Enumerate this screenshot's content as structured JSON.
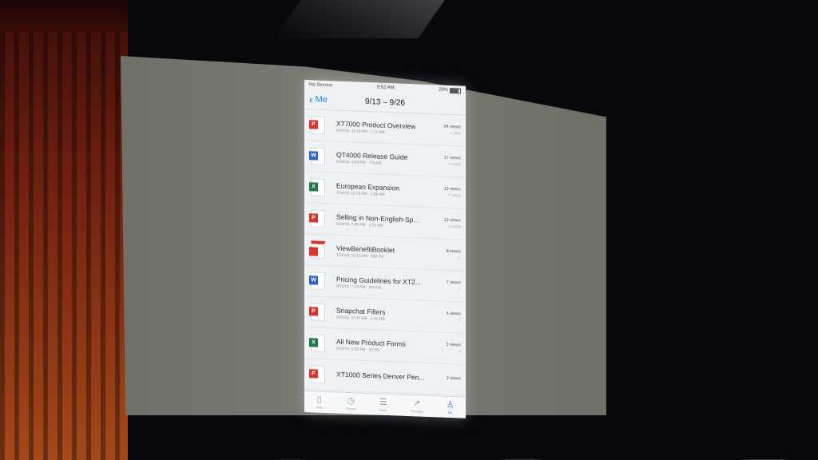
{
  "status_bar": {
    "carrier": "No Service",
    "time": "9:52 AM",
    "battery": "28%"
  },
  "nav": {
    "back_label": "Me",
    "title": "9/13 – 9/26"
  },
  "files": [
    {
      "icon": "powerpoint-icon",
      "type": "ppt",
      "badge": "P",
      "title": "XT7000 Product Overview",
      "meta": "9/20/16, 10:16 AM · 1.11 MB",
      "views": "54 views",
      "trend": "↗ 26%"
    },
    {
      "icon": "word-icon",
      "type": "doc",
      "badge": "W",
      "title": "QT4000 Release Guide",
      "meta": "9/16/16, 3:03 PM · 776 KB",
      "views": "17 views",
      "trend": "↗ 100%"
    },
    {
      "icon": "excel-icon",
      "type": "xls",
      "badge": "X",
      "title": "European Expansion",
      "meta": "9/16/16, 11:03 AM · 1.95 MB",
      "views": "13 views",
      "trend": "↗ 100%"
    },
    {
      "icon": "powerpoint-icon",
      "type": "ppt",
      "badge": "P",
      "title": "Selling in Non-English-Sp...",
      "meta": "9/16/16, 7:45 PM · 1.15 MB",
      "views": "13 views",
      "trend": "↗ 100%"
    },
    {
      "icon": "pdf-icon",
      "type": "pdf",
      "badge": "",
      "title": "ViewBenefitBooklet",
      "meta": "1/22/16, 10:15 AM · 208 KB",
      "views": "8 views",
      "trend": "↗"
    },
    {
      "icon": "word-icon",
      "type": "doc",
      "badge": "W",
      "title": "Pricing Guidelines for XT2...",
      "meta": "9/22/16, 7:12 PM · 378 KB",
      "views": "7 views",
      "trend": "↗"
    },
    {
      "icon": "powerpoint-icon",
      "type": "ppt",
      "badge": "P",
      "title": "Snapchat Filters",
      "meta": "9/20/16, 11:47 AM · 1.41 MB",
      "views": "5 views",
      "trend": "↗"
    },
    {
      "icon": "excel-icon",
      "type": "xls",
      "badge": "X",
      "title": "All New Product Forms",
      "meta": "9/19/16, 2:00 AM · 18 KB",
      "views": "5 views",
      "trend": "↗"
    },
    {
      "icon": "powerpoint-icon",
      "type": "ppt",
      "badge": "P",
      "title": "XT1000 Series Denver Pen...",
      "meta": "",
      "views": "3 views",
      "trend": ""
    }
  ],
  "tab_bar": [
    {
      "icon": "document-icon",
      "glyph": "▯",
      "label": "Files",
      "active": false
    },
    {
      "icon": "clock-icon",
      "glyph": "◷",
      "label": "Recent",
      "active": false
    },
    {
      "icon": "list-icon",
      "glyph": "☰",
      "label": "Docs",
      "active": false
    },
    {
      "icon": "trending-icon",
      "glyph": "↗",
      "label": "Trending",
      "active": false
    },
    {
      "icon": "person-icon",
      "glyph": "♙",
      "label": "Me",
      "active": true
    }
  ]
}
